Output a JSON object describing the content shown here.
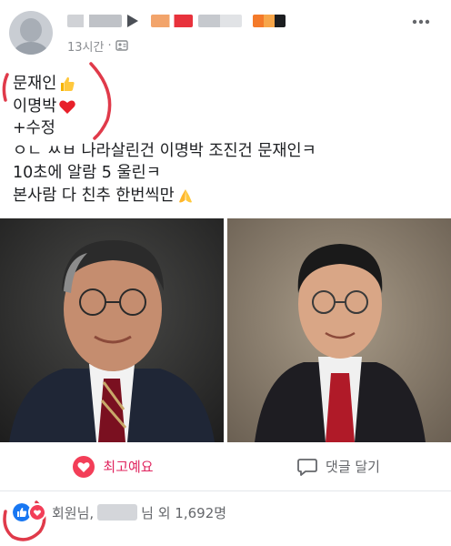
{
  "post": {
    "time": "13시간",
    "separator": "·",
    "lines": [
      "문재인",
      "이명박",
      "+수정",
      "ㅇㄴ ㅆㅂ 나라살린건 이명박 조진건 문재인ㅋ",
      "10초에 알람 5 울린ㅋ",
      "본사람 다 친추 한번씩만"
    ],
    "line_icons": [
      "thumbs-up-emoji",
      "red-heart-emoji",
      "",
      "",
      "",
      "folded-hands-emoji"
    ]
  },
  "actions": {
    "like_label": "최고예요",
    "comment_label": "댓글 달기"
  },
  "reactions": {
    "icons": [
      "like-icon",
      "love-icon"
    ],
    "name1": "회원님,",
    "name2_suffix": "님 외 1,692명"
  },
  "colors": {
    "accent_red": "#e0245e",
    "like_blue": "#1877f2",
    "love_red": "#f33e58",
    "text": "#1c1e21",
    "muted": "#65676b"
  }
}
